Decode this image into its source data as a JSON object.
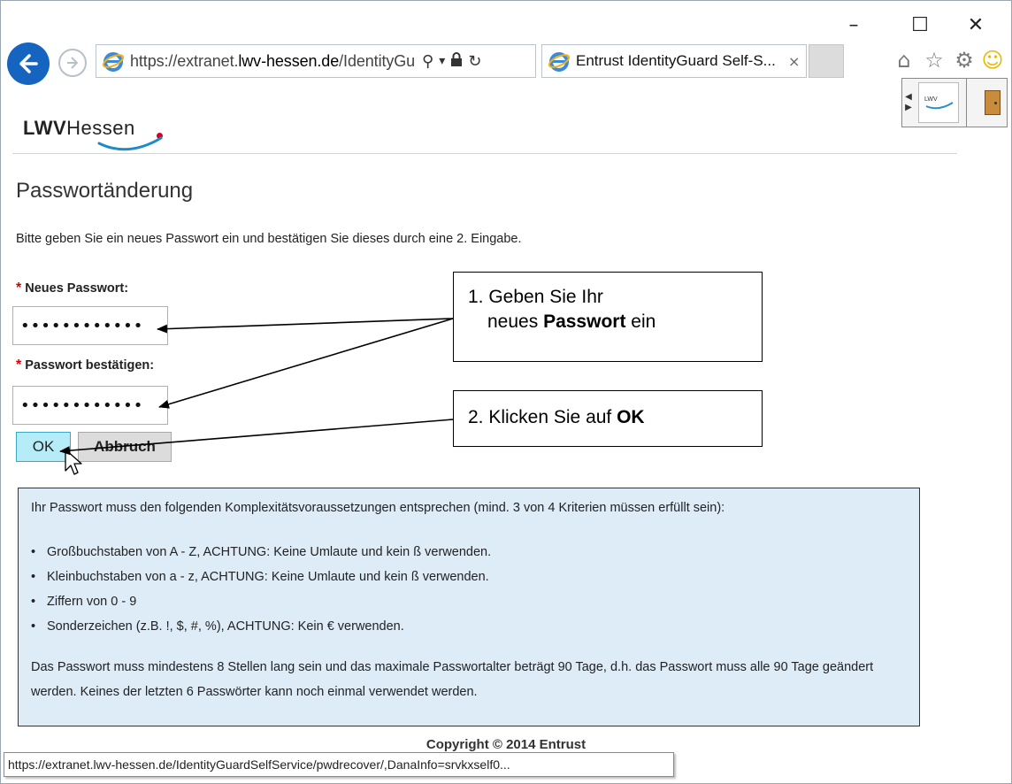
{
  "window_controls": {
    "minimize": "–",
    "maximize": "☐",
    "close": "✕"
  },
  "toolbar": {
    "url_prefix": "https://extranet.",
    "url_domain": "lwv-hessen.de",
    "url_path": "/IdentityGuar",
    "tab_title": "Entrust IdentityGuard Self-S...",
    "tab_close": "×",
    "search_glyph": "⚲",
    "dropdown_glyph": "▾",
    "lock_glyph": "🔒",
    "refresh_glyph": "↻",
    "home_glyph": "⌂",
    "star_glyph": "☆",
    "gear_glyph": "⚙",
    "smiley_glyph": "☺"
  },
  "logo": {
    "bold": "LWV",
    "light": "Hessen"
  },
  "page": {
    "title": "Passwortänderung",
    "intro": "Bitte geben Sie ein neues Passwort ein und bestätigen Sie dieses durch eine 2. Eingabe.",
    "required_mark": "*",
    "new_password_label": "Neues Passwort:",
    "new_password_value": "••••••••••••",
    "confirm_password_label": "Passwort bestätigen:",
    "confirm_password_value": "••••••••••••",
    "ok_label": "OK",
    "cancel_label": "Abbruch"
  },
  "callouts": {
    "step1_line1": "1. Geben Sie Ihr",
    "step1_line2_pre": "neues ",
    "step1_line2_bold": "Passwort",
    "step1_line2_post": " ein",
    "step2_pre": "2. Klicken Sie auf ",
    "step2_bold": "OK"
  },
  "info": {
    "intro": "Ihr Passwort muss den folgenden Komplexitätsvoraussetzungen entsprechen (mind. 3 von 4 Kriterien müssen erfüllt sein):",
    "bullet": "•",
    "rules": [
      "Großbuchstaben von A - Z, ACHTUNG: Keine Umlaute und kein ß verwenden.",
      "Kleinbuchstaben von a - z, ACHTUNG: Keine Umlaute und kein ß verwenden.",
      "Ziffern von 0 - 9",
      "Sonderzeichen (z.B. !, $, #, %), ACHTUNG: Kein € verwenden."
    ],
    "note": "Das Passwort muss mindestens 8 Stellen lang sein und das maximale Passwortalter beträgt 90 Tage, d.h. das Passwort muss alle 90 Tage geändert werden. Keines der letzten 6 Passwörter kann noch einmal verwendet werden."
  },
  "footer": {
    "copyright": "Copyright © 2014 Entrust",
    "status_url": "https://extranet.lwv-hessen.de/IdentityGuardSelfService/pwdrecover/,DanaInfo=srvkxself0..."
  },
  "colors": {
    "accent_blue": "#1565c0",
    "required_red": "#d80000",
    "ok_button": "#b6ecf8",
    "info_bg": "#deecf8"
  }
}
